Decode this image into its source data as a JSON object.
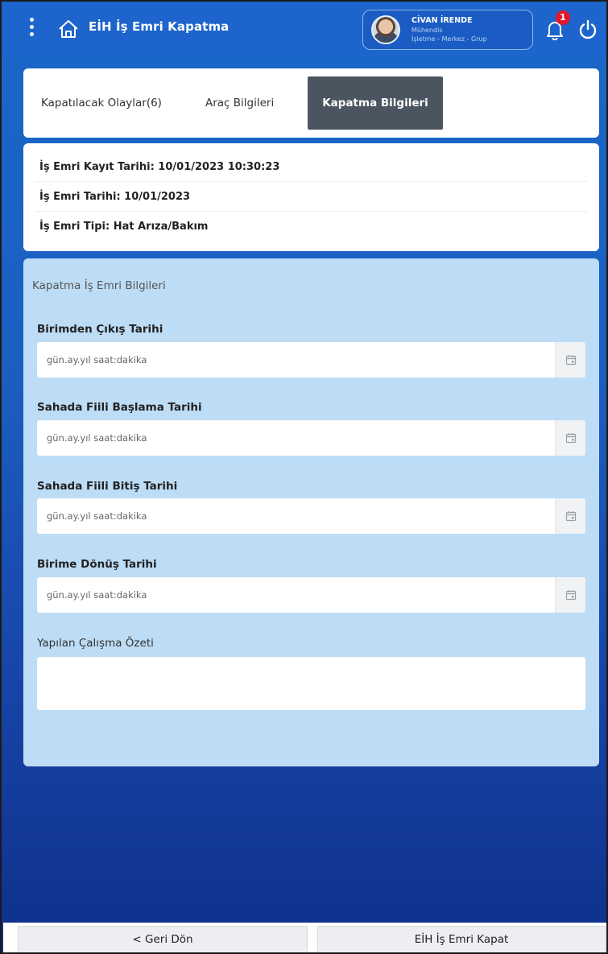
{
  "header": {
    "title": "EİH İş Emri Kapatma",
    "notification_count": "1"
  },
  "user": {
    "name": "CİVAN İRENDE",
    "role": "Mühendis",
    "org": "İşletme - Merkez - Grup"
  },
  "tabs": [
    {
      "label": "Kapatılacak Olaylar(6)"
    },
    {
      "label": "Araç Bilgileri"
    },
    {
      "label": "Kapatma Bilgileri",
      "active": true
    }
  ],
  "info": {
    "kayit_tarihi": "İş Emri Kayıt Tarihi: 10/01/2023 10:30:23",
    "tarih": "İş Emri Tarihi: 10/01/2023",
    "tip": "İş Emri Tipi: Hat Arıza/Bakım"
  },
  "form": {
    "title": "Kapatma İş Emri Bilgileri",
    "fields": [
      {
        "label": "Birimden Çıkış Tarihi",
        "placeholder": "gün.ay.yıl saat:dakika"
      },
      {
        "label": "Sahada Fiili Başlama Tarihi",
        "placeholder": "gün.ay.yıl saat:dakika"
      },
      {
        "label": "Sahada Fiili Bitiş Tarihi",
        "placeholder": "gün.ay.yıl saat:dakika"
      },
      {
        "label": "Birime Dönüş Tarihi",
        "placeholder": "gün.ay.yıl saat:dakika"
      }
    ],
    "summary_label": "Yapılan Çalışma Özeti",
    "summary_value": ""
  },
  "footer": {
    "back_label": "< Geri Dön",
    "close_label": "EİH İş Emri Kapat"
  },
  "colors": {
    "header": "#1d64cc",
    "active_tab": "#4a5560",
    "form_bg": "#bddcf5",
    "badge": "#e0182d"
  }
}
